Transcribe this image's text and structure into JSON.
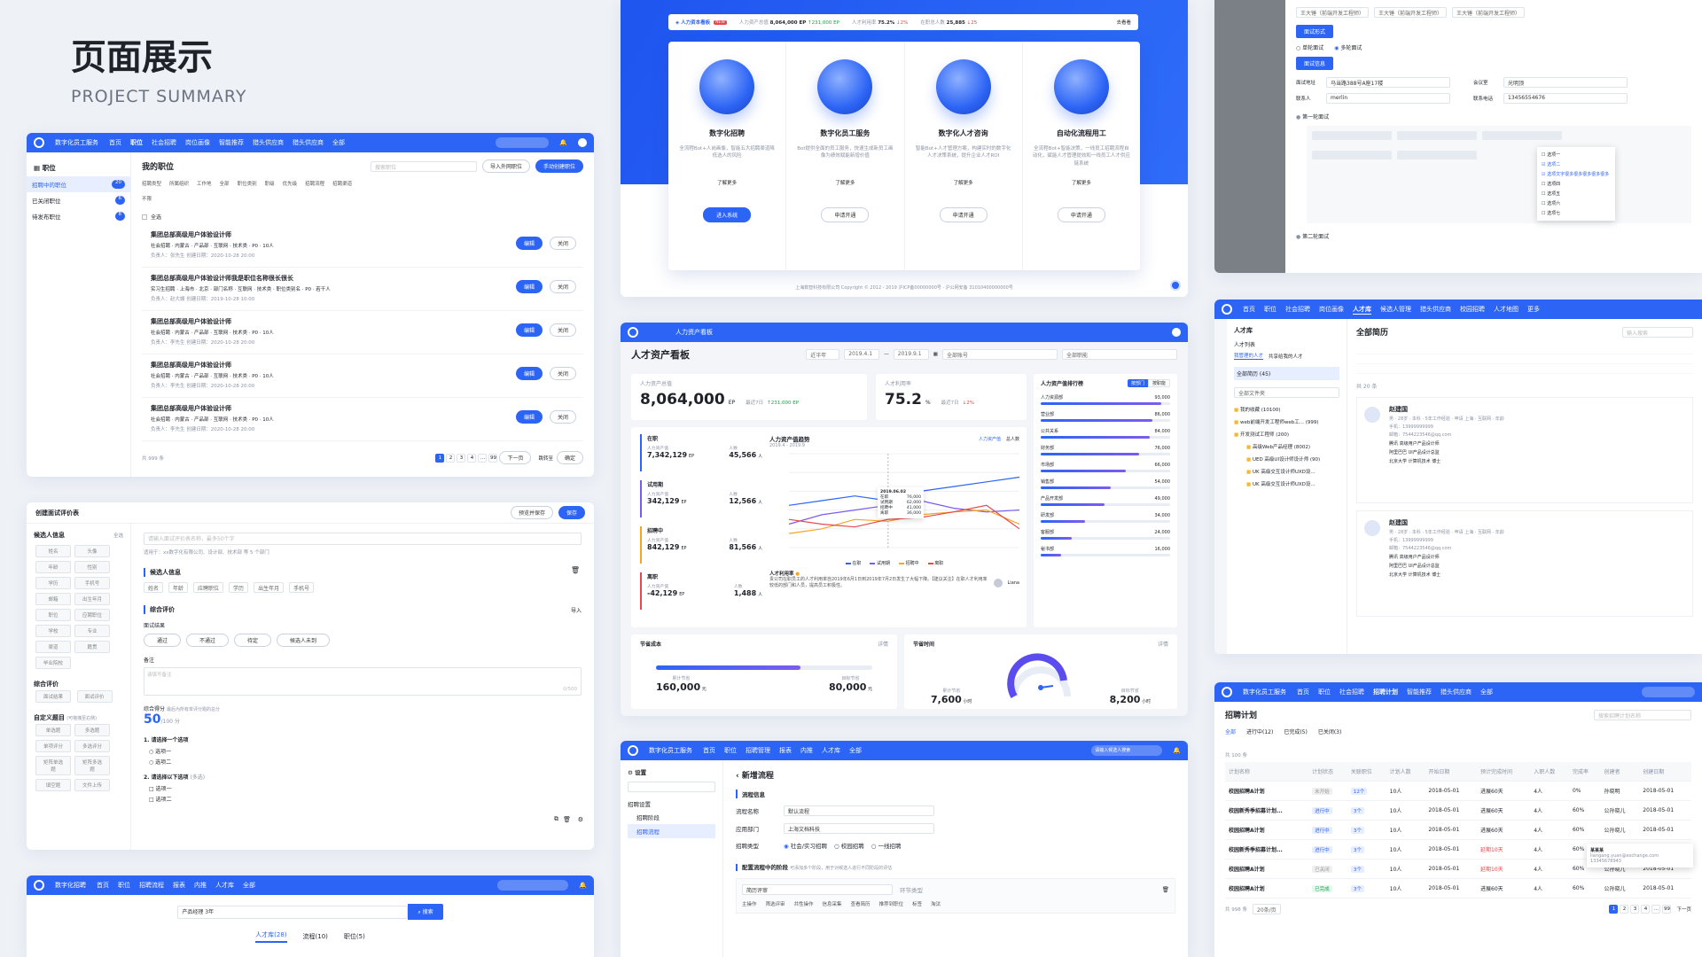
{
  "hero": {
    "title": "页面展示",
    "subtitle": "PROJECT SUMMARY"
  },
  "colors": {
    "primary": "#2c64f5",
    "bg": "#eef1f6",
    "up": "#17a34a",
    "down": "#e5484d"
  },
  "app1": {
    "brand": "数字化员工服务",
    "nav": [
      "首页",
      "职位",
      "社会招聘",
      "岗位画像",
      "智能推荐",
      "猎头供应商",
      "猎头供应商",
      "全部"
    ],
    "side_title": "职位",
    "side_items": [
      {
        "label": "招聘中的职位",
        "count": "20"
      },
      {
        "label": "已关闭职位",
        "count": "6"
      },
      {
        "label": "待发布职位",
        "count": "8"
      }
    ],
    "page_title": "我的职位",
    "search_placeholder": "搜索职位",
    "import_btn": "导入外网职位",
    "new_btn": "手动创建职位",
    "filters": [
      "招聘类型",
      "所属组织",
      "工作地",
      "全部",
      "职位类别",
      "职级",
      "优先级",
      "招聘流程",
      "招聘渠道",
      "不限"
    ],
    "select_all": "全选",
    "jobs": [
      {
        "title": "集团总部高级用户体验设计师",
        "meta": "社会招聘 · 内蒙古 · 产品部 · 互联网 · 技术类 · P0 · 10人",
        "owner": "负责人：张先生  创建日期：2020-10-28 20:00"
      },
      {
        "title": "集团总部高级用户体验设计师我是职位名称很长很长",
        "meta": "实习生招聘 · 上海市 · 北京 · 部门名称 · 互联网 · 技术类 · 职位类别名 · P0 · 若干人",
        "owner": "负责人：赵大嫂  创建日期：2019-10-28 10:00"
      },
      {
        "title": "集团总部高级用户体验设计师",
        "meta": "社会招聘 · 内蒙古 · 产品部 · 互联网 · 技术类 · P0 · 10人",
        "owner": "负责人：李先生  创建日期：2020-10-28 20:00"
      },
      {
        "title": "集团总部高级用户体验设计师",
        "meta": "社会招聘 · 内蒙古 · 产品部 · 互联网 · 技术类 · P0 · 10人",
        "owner": "负责人：李先生  创建日期：2020-10-28 20:00"
      },
      {
        "title": "集团总部高级用户体验设计师",
        "meta": "社会招聘 · 内蒙古 · 产品部 · 互联网 · 技术类 · P0 · 10人",
        "owner": "负责人：李先生  创建日期：2020-10-28 20:00"
      }
    ],
    "edit_label": "编辑",
    "close_label": "关闭",
    "total": "共 999 条",
    "per_page": "20条/页",
    "pages": [
      "1",
      "2",
      "3",
      "4",
      "...",
      "99"
    ],
    "next": "下一页",
    "goto": "跳转至",
    "confirm": "确定"
  },
  "app2": {
    "title": "创建面试评价表",
    "preview": "预览并保存",
    "save": "保存",
    "cand_title": "候选人信息",
    "all": "全选",
    "chips": [
      "姓名",
      "头像",
      "年龄",
      "性别",
      "学历",
      "手机号",
      "邮箱",
      "出生年月",
      "职位",
      "应聘职位",
      "学校",
      "专业",
      "渠道",
      "籍贯",
      "毕业院校"
    ],
    "eval_title": "综合评价",
    "eval_chips": [
      "面试结果",
      "面试评价"
    ],
    "custom_title": "自定义题目",
    "custom_hint": "(可拖拽至右侧)",
    "custom_chips": [
      "单选题",
      "多选题",
      "单项评分",
      "多选评分",
      "矩阵单选题",
      "矩阵多选题",
      "填空题",
      "文件上传"
    ],
    "desc_placeholder": "请输入面试评价表名称，最多50个字",
    "desc_sub": "适用于：xx数字化有限公司、设计部、技术部 等 5 个部门",
    "sec1": "候选人信息",
    "sec1_fields": [
      "姓名",
      "年龄",
      "应聘职位",
      "学历",
      "出生年月",
      "手机号"
    ],
    "sec2": "综合评价",
    "import": "导入",
    "result_label": "面试结果",
    "results": [
      "通过",
      "不通过",
      "待定",
      "候选人未到"
    ],
    "remark_label": "备注",
    "remark_placeholder": "请填写备注",
    "remark_count": "0/500",
    "score_label": "综合得分",
    "score_hint": "最后为所有单评分题的总分",
    "score_value": "50",
    "score_total": "/100 分",
    "q1": "1. 请选择一个选项",
    "q1_opts": [
      "选项一",
      "选项二"
    ],
    "q2": "2. 请选择以下选项",
    "q2_tag": "(多选)",
    "q2_opts": [
      "选项一",
      "选项二"
    ]
  },
  "app3": {
    "brand": "数字化招聘",
    "nav": [
      "首页",
      "职位",
      "招聘流程",
      "报表",
      "内推",
      "人才库",
      "全部"
    ],
    "search_value": "产品经理 3年",
    "search_btn": "搜索",
    "tabs": [
      "人才库(28)",
      "流程(10)",
      "职位(5)"
    ]
  },
  "portal": {
    "ticker_title": "人力资本看板",
    "ticker_new": "NEW",
    "ticker_items": [
      {
        "label": "人力资产总值",
        "value": "8,064,000 EP",
        "delta": "↑231,000 EP",
        "up": true
      },
      {
        "label": "人才利用率",
        "value": "75.2%",
        "delta": "↓2%",
        "up": false
      },
      {
        "label": "在职总人数",
        "value": "25,885",
        "delta": "↓25",
        "up": false
      }
    ],
    "ticker_more": "去看看",
    "services": [
      {
        "name": "数字化招聘",
        "desc": "全流程Bot+人岗画像，智能五大招聘渠道降低选人的风险",
        "more": "了解更多",
        "btn": "进入系统",
        "primary": true
      },
      {
        "name": "数字化员工服务",
        "desc": "Bot提供全面的员工服务，快速生成新员工画像为绩效赋能新增价值",
        "more": "了解更多",
        "btn": "申请开通",
        "primary": false
      },
      {
        "name": "数字化人才咨询",
        "desc": "智能Bot+人才管理方案，构建实时的数字化人才决策系统，提升企业人才ROI",
        "more": "了解更多",
        "btn": "申请开通",
        "primary": false
      },
      {
        "name": "自动化流程用工",
        "desc": "全流程Bot+智能决策，一线员工招聘流程自动化，赋能人才管理提效和一线员工人才供应链系统",
        "more": "了解更多",
        "btn": "申请开通",
        "primary": false
      }
    ],
    "footer": "上海数智科技有限公司 Copyright © 2012 - 2019 沪ICP备00000000号 · 沪公网安备 31010400000000号"
  },
  "dash": {
    "top_title": "人力资产看板",
    "title": "人才资产看板",
    "filters": [
      "近半年",
      "2019.4.1",
      "2019.9.1",
      "全部账号",
      "全部职能"
    ],
    "kpi1_label": "人力资产总值",
    "kpi1_value": "8,064,000",
    "kpi1_unit": "EP",
    "kpi1_delta_label": "最近7日",
    "kpi1_delta": "↑231,000 EP",
    "kpi2_label": "人才利用率",
    "kpi2_value": "75.2",
    "kpi2_unit": "%",
    "kpi2_delta_label": "最近7日",
    "kpi2_delta": "↓2%",
    "rank_title": "人力资产值排行榜",
    "rank_tabs": [
      "按部门",
      "按职能"
    ],
    "ranks": [
      {
        "name": "人力资源部",
        "value": "93,000",
        "pct": 0.93
      },
      {
        "name": "营业部",
        "value": "86,000",
        "pct": 0.86
      },
      {
        "name": "公共关系",
        "value": "84,000",
        "pct": 0.84
      },
      {
        "name": "财务部",
        "value": "76,000",
        "pct": 0.76
      },
      {
        "name": "市场部",
        "value": "66,000",
        "pct": 0.66
      },
      {
        "name": "销售部",
        "value": "54,000",
        "pct": 0.54
      },
      {
        "name": "产品开发部",
        "value": "49,000",
        "pct": 0.49
      },
      {
        "name": "研发部",
        "value": "34,000",
        "pct": 0.34
      },
      {
        "name": "客服部",
        "value": "24,000",
        "pct": 0.24
      },
      {
        "name": "秘书部",
        "value": "16,000",
        "pct": 0.16
      }
    ],
    "status": [
      {
        "name": "在职",
        "assets_label": "人力资产值",
        "assets": "7,342,129",
        "unit": "EP",
        "people_label": "人数",
        "people": "45,566",
        "punit": "人",
        "color": "#2c64f5"
      },
      {
        "name": "试用期",
        "assets_label": "人力资产值",
        "assets": "342,129",
        "unit": "EP",
        "people_label": "人数",
        "people": "12,566",
        "punit": "人",
        "color": "#7b5cf0"
      },
      {
        "name": "招聘中",
        "assets_label": "人力资产值",
        "assets": "842,129",
        "unit": "EP",
        "people_label": "人数",
        "people": "81,566",
        "punit": "人",
        "color": "#f5a623"
      },
      {
        "name": "离职",
        "assets_label": "人力资产值",
        "assets": "-42,129",
        "unit": "EP",
        "people_label": "人数",
        "people": "1,488",
        "punit": "人",
        "color": "#e5484d"
      }
    ],
    "trend_title": "人力资产值趋势",
    "trend_range": "2019.4 - 2019.9",
    "trend_tabs": [
      "人力资产值",
      "总人数"
    ],
    "tooltip": {
      "date": "2019.06.02",
      "rows": [
        [
          "在职",
          "76,000"
        ],
        [
          "试用期",
          "62,000"
        ],
        [
          "招聘中",
          "41,000"
        ],
        [
          "离职",
          "36,000"
        ]
      ]
    },
    "util_title": "人才利用率",
    "util_text": "贵公司在职员工的人才利用率自2019年6月1日到2019年7月2日发生了大幅下降。【建议关注】在职人才利用率较低的部门和人员，提高员工积极性。",
    "util_person": "Liana",
    "save_title": "节省成本",
    "save_detail": "详情",
    "save_a_label": "累计节省",
    "save_a": "160,000",
    "save_b_label": "目标节省",
    "save_b": "80,000",
    "save_unit": "元",
    "save_pct": 0.67,
    "time_title": "节省时间",
    "time_detail": "详情",
    "time_a_label": "累计节省",
    "time_a": "7,600",
    "time_b_label": "目标节省",
    "time_b": "8,200",
    "time_unit": "小时"
  },
  "flow": {
    "brand": "数字化员工服务",
    "nav": [
      "首页",
      "职位",
      "招聘管理",
      "报表",
      "内推",
      "人才库",
      "全部"
    ],
    "search_placeholder": "请输入候选人搜索",
    "side_title": "设置",
    "side_group": "招聘设置",
    "side_items": [
      "招聘阶段",
      "招聘流程"
    ],
    "page_title": "新增流程",
    "sec1": "流程信息",
    "name_label": "流程名称",
    "name_value": "默认流程",
    "dept_label": "应用部门",
    "dept_value": "上海文档科技",
    "type_label": "招聘类型",
    "types": [
      "社会/实习招聘",
      "校园招聘",
      "一线招聘"
    ],
    "sec2": "配置流程中的阶段",
    "sec2_hint": "可添加多个阶段，用于对候选人进行不同阶段的评估",
    "stage": "简历评审",
    "stage_type": "环节类型",
    "stage_items": [
      "主操作",
      "筛选评审",
      "共性操作",
      "信息采集",
      "查看简历",
      "推荐到职位",
      "标签",
      "淘汰"
    ]
  },
  "interview": {
    "tabs": [
      "王大锤（前端开发工程师）",
      "王大锤（前端开发工程师）",
      "王大锤（前端开发工程师）"
    ],
    "sec1": "面试形式",
    "mode1": "单轮面试",
    "mode2": "多轮面试",
    "sec2": "面试信息",
    "addr_label": "面试地址",
    "addr": "马当路388号A座17楼",
    "room_label": "会议室",
    "room": "光明顶",
    "contact_label": "联系人",
    "contact": "merlin",
    "phone_label": "联系电话",
    "phone": "13456554676",
    "round1": "第一轮面试",
    "round2": "第二轮面试",
    "dropdown": [
      "选项一",
      "选项二",
      "选项文字很多很多很多很多很多",
      "选项四",
      "选项五",
      "选项六",
      "选项七"
    ]
  },
  "talent": {
    "nav": [
      "首页",
      "职位",
      "社会招聘",
      "岗位画像",
      "人才库",
      "候选人管理",
      "猎头供应商",
      "校园招聘",
      "人才地图",
      "更多"
    ],
    "side_title": "人才库",
    "side_sub": "人才列表",
    "side_tabs": [
      "我管理的人才",
      "共享给我的人才"
    ],
    "all": "全部简历 (45)",
    "folder_select": "全部文件夹",
    "folders": [
      "我的收藏 (10100)",
      "web前端开发工程师web工... (999)",
      "开发测试工程师 (200)",
      "高级Web产品经理 (8002)",
      "UED 高级UI设计师设计师 (90)",
      "UK 高级交互设计师UXD设...",
      "UK 高级交互设计师UXD设..."
    ],
    "page_title": "全部简历",
    "search_placeholder": "输入搜索",
    "count": "共 20 条",
    "candidates": [
      {
        "name": "赵建国",
        "meta": "男 · 28岁 · 本科 · 5年工作经验 · 申请 上海 · 互联网 · 年龄",
        "phone": "手机：13999999999",
        "email": "邮箱：7544223546@qq.com",
        "exp": [
          "腾讯 高级用户产品设计师",
          "阿里巴巴 UI产品设计总监",
          "北京大学 计算机技术 博士"
        ]
      },
      {
        "name": "赵建国",
        "meta": "男 · 28岁 · 本科 · 5年工作经验 · 申请 上海 · 互联网 · 年龄",
        "phone": "手机：13999999999",
        "email": "邮箱：7544223546@qq.com",
        "exp": [
          "腾讯 高级用户产品设计师",
          "阿里巴巴 UI产品设计总监",
          "北京大学 计算机技术 博士"
        ]
      }
    ]
  },
  "plan": {
    "brand": "数字化员工服务",
    "nav": [
      "首页",
      "职位",
      "社会招聘",
      "招聘计划",
      "智能推荐",
      "猎头供应商",
      "全部"
    ],
    "title": "招聘计划",
    "search_placeholder": "搜索招聘计划名称",
    "tabs": [
      "全部",
      "进行中(12)",
      "已完成(5)",
      "已关闭(3)"
    ],
    "total_rows": "共 100 条",
    "headers": [
      "计划名称",
      "计划状态",
      "关联职位",
      "计划人数",
      "开始日期",
      "预计完成时间",
      "入职人数",
      "完成率",
      "创建者",
      "创建日期"
    ],
    "rows": [
      [
        "校园招聘A计划",
        "未开始",
        "12个",
        "10人",
        "2018-05-01",
        "进展60天",
        "4人",
        "0%",
        "孙晓明",
        "2018-05-01"
      ],
      [
        "校园新秀季招募计划...",
        "进行中",
        "3个",
        "10人",
        "2018-05-01",
        "进展60天",
        "4人",
        "60%",
        "公孙晓儿",
        "2018-05-01"
      ],
      [
        "校园招聘A计划",
        "进行中",
        "3个",
        "10人",
        "2018-05-01",
        "进展60天",
        "4人",
        "60%",
        "公孙晓儿",
        "2018-05-01"
      ],
      [
        "校园新秀季招募计划...",
        "进行中",
        "3个",
        "10人",
        "2018-05-01",
        "延期10天",
        "4人",
        "60%",
        "公孙晓儿",
        "2018-05-01"
      ],
      [
        "校园招聘A计划",
        "已关闭",
        "3个",
        "10人",
        "2018-05-01",
        "延期10天",
        "4人",
        "60%",
        "公孙晓儿",
        "2018-05-01"
      ],
      [
        "校园招聘A计划",
        "已完成",
        "3个",
        "10人",
        "2018-05-01",
        "进展60天",
        "4人",
        "60%",
        "公孙晓儿",
        "2018-05-01"
      ]
    ],
    "popover_name": "某某某",
    "popover_mail": "liangang.yuan@exchange.com 13345678943",
    "total": "共 998 条",
    "per_page": "20条/页",
    "pages": [
      "1",
      "2",
      "3",
      "4",
      "...",
      "99"
    ],
    "next": "下一页"
  }
}
